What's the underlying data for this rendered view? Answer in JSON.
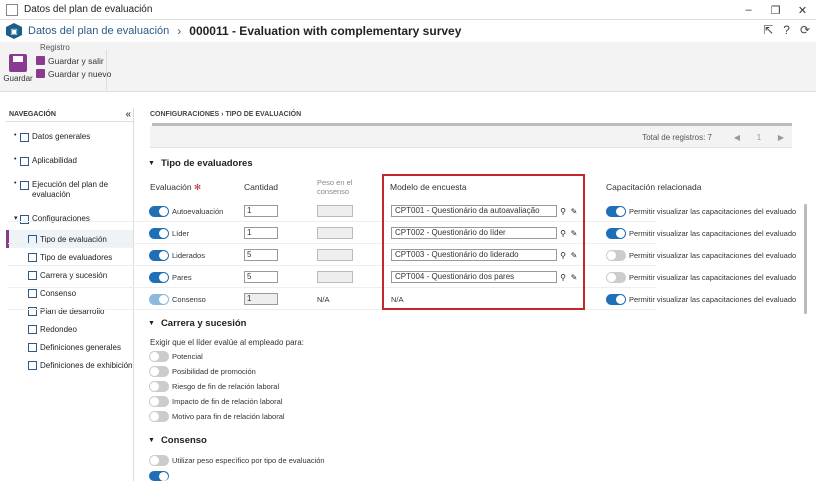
{
  "window": {
    "title": "Datos del plan de evaluación",
    "controls": [
      "–",
      "❐",
      "✕"
    ]
  },
  "header": {
    "crumb_parent": "Datos del plan de evaluación",
    "separator": "›",
    "title": "000011 - Evaluation with complementary survey"
  },
  "ribbon": {
    "group_label": "Registro",
    "save_label": "Guardar",
    "save_exit_label": "Guardar y salir",
    "save_new_label": "Guardar y nuevo"
  },
  "nav": {
    "heading": "NAVEGACIÓN",
    "items": [
      {
        "label": "Datos generales"
      },
      {
        "label": "Aplicabilidad"
      },
      {
        "label": "Ejecución del plan de evaluación"
      },
      {
        "label": "Configuraciones"
      }
    ],
    "subitems": [
      {
        "label": "Tipo de evaluación"
      },
      {
        "label": "Tipo de evaluadores"
      },
      {
        "label": "Carrera y sucesión"
      },
      {
        "label": "Consenso"
      },
      {
        "label": "Plan de desarrollo"
      },
      {
        "label": "Redondeo"
      },
      {
        "label": "Definiciones generales"
      },
      {
        "label": "Definiciones de exhibición"
      }
    ]
  },
  "main": {
    "breadcrumb": "CONFIGURACIONES  ›  TIPO DE EVALUACIÓN",
    "pager": {
      "total": "Total de registros: 7",
      "page": "1",
      "prev": "◀",
      "next": "▶"
    },
    "evaluators": {
      "title": "Tipo de evaluadores",
      "headers": {
        "evaluation": "Evaluación",
        "quantity": "Cantidad",
        "weight": "Peso en el consenso",
        "survey": "Modelo de encuesta",
        "capability": "Capacitación relacionada"
      },
      "rows": [
        {
          "label": "Autoevaluación",
          "qty": "1",
          "survey": "CPT001 - Questionário da autoavaliação",
          "cap": "Permitir visualizar las capacitaciones del evaluado"
        },
        {
          "label": "Líder",
          "qty": "1",
          "survey": "CPT002 - Questionário do líder",
          "cap": "Permitir visualizar las capacitaciones del evaluado"
        },
        {
          "label": "Liderados",
          "qty": "5",
          "survey": "CPT003 - Questionário do liderado",
          "cap": "Permitir visualizar las capacitaciones del evaluado"
        },
        {
          "label": "Pares",
          "qty": "5",
          "survey": "CPT004 - Questionário dos pares",
          "cap": "Permitir visualizar las capacitaciones del evaluado"
        },
        {
          "label": "Consenso",
          "qty": "1",
          "weight": "N/A",
          "survey": "N/A",
          "cap": "Permitir visualizar las capacitaciones del evaluado"
        }
      ]
    },
    "career": {
      "title": "Carrera y sucesión",
      "prompt": "Exigir que el líder evalúe al empleado para:",
      "options": [
        "Potencial",
        "Posibilidad de promoción",
        "Riesgo de fin de relación laboral",
        "Impacto de fin de relación laboral",
        "Motivo para fin de relación laboral"
      ]
    },
    "consensus": {
      "title": "Consenso",
      "option": "Utilizar peso específico por tipo de evaluación"
    }
  },
  "colors": {
    "accent": "#1e6fb5",
    "brand": "#8a3a8f",
    "highlight": "#c1272d"
  }
}
